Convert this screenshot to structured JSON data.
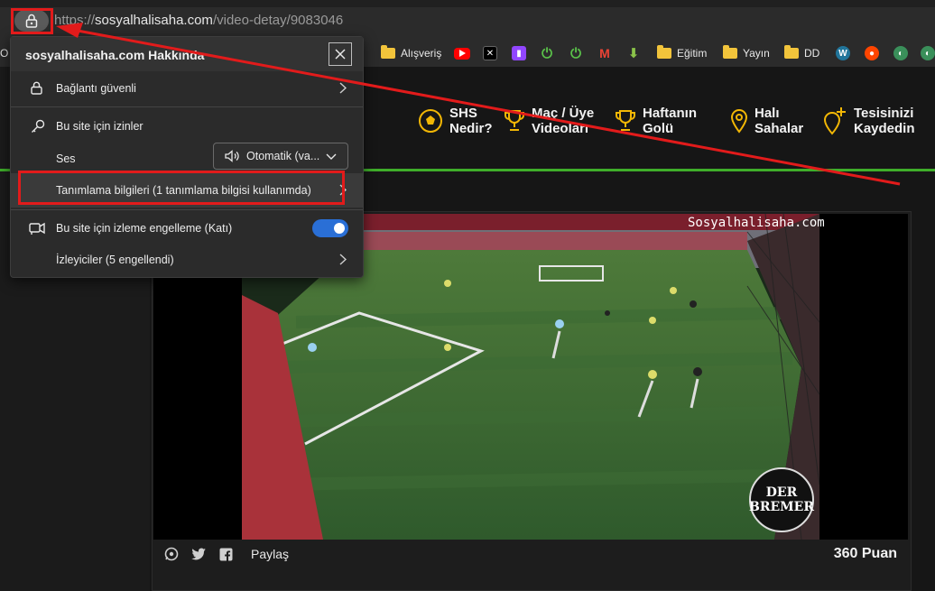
{
  "browser": {
    "url_scheme": "https://",
    "url_host": "sosyalhalisaha.com",
    "url_path": "/video-detay/9083046"
  },
  "bookmarks": [
    {
      "label": "Alışveriş",
      "icon": "folder-icon"
    },
    {
      "label": "",
      "icon": "youtube-icon"
    },
    {
      "label": "",
      "icon": "x-icon"
    },
    {
      "label": "",
      "icon": "twitch-icon"
    },
    {
      "label": "",
      "icon": "power-icon"
    },
    {
      "label": "",
      "icon": "power-icon"
    },
    {
      "label": "",
      "icon": "gmail-icon"
    },
    {
      "label": "",
      "icon": "download-icon"
    },
    {
      "label": "Eğitim",
      "icon": "folder-icon"
    },
    {
      "label": "Yayın",
      "icon": "folder-icon"
    },
    {
      "label": "DD",
      "icon": "folder-icon"
    }
  ],
  "site_nav": [
    {
      "line1": "SHS",
      "line2": "Nedir?",
      "icon": "soccer-ball-icon"
    },
    {
      "line1": "Maç / Üye",
      "line2": "Videoları",
      "icon": "trophy-icon"
    },
    {
      "line1": "Haftanın",
      "line2": "Golü",
      "icon": "trophy-icon"
    },
    {
      "line1": "Halı",
      "line2": "Sahalar",
      "icon": "location-pin-icon"
    },
    {
      "line1": "Tesisinizi",
      "line2": "Kaydedin",
      "icon": "add-location-icon"
    }
  ],
  "popup": {
    "title": "sosyalhalisaha.com Hakkında",
    "connection": "Bağlantı güvenli",
    "permissions": "Bu site için izinler",
    "sound_label": "Ses",
    "sound_value": "Otomatik (va...",
    "cookies": "Tanımlama bilgileri (1 tanımlama bilgisi kullanımda)",
    "tracking": "Bu site için izleme engelleme (Katı)",
    "trackers": "İzleyiciler (5 engellendi)"
  },
  "video": {
    "watermark": "Sosyalhalisaha.com",
    "badge_line1": "DER",
    "badge_line2": "BREMER",
    "share_label": "Paylaş",
    "points": "360 Puan"
  },
  "colors": {
    "accent_green": "#3fae2a",
    "nav_gold": "#f2b705",
    "annotation_red": "#e21b1b",
    "toggle_blue": "#2a6fd6"
  }
}
